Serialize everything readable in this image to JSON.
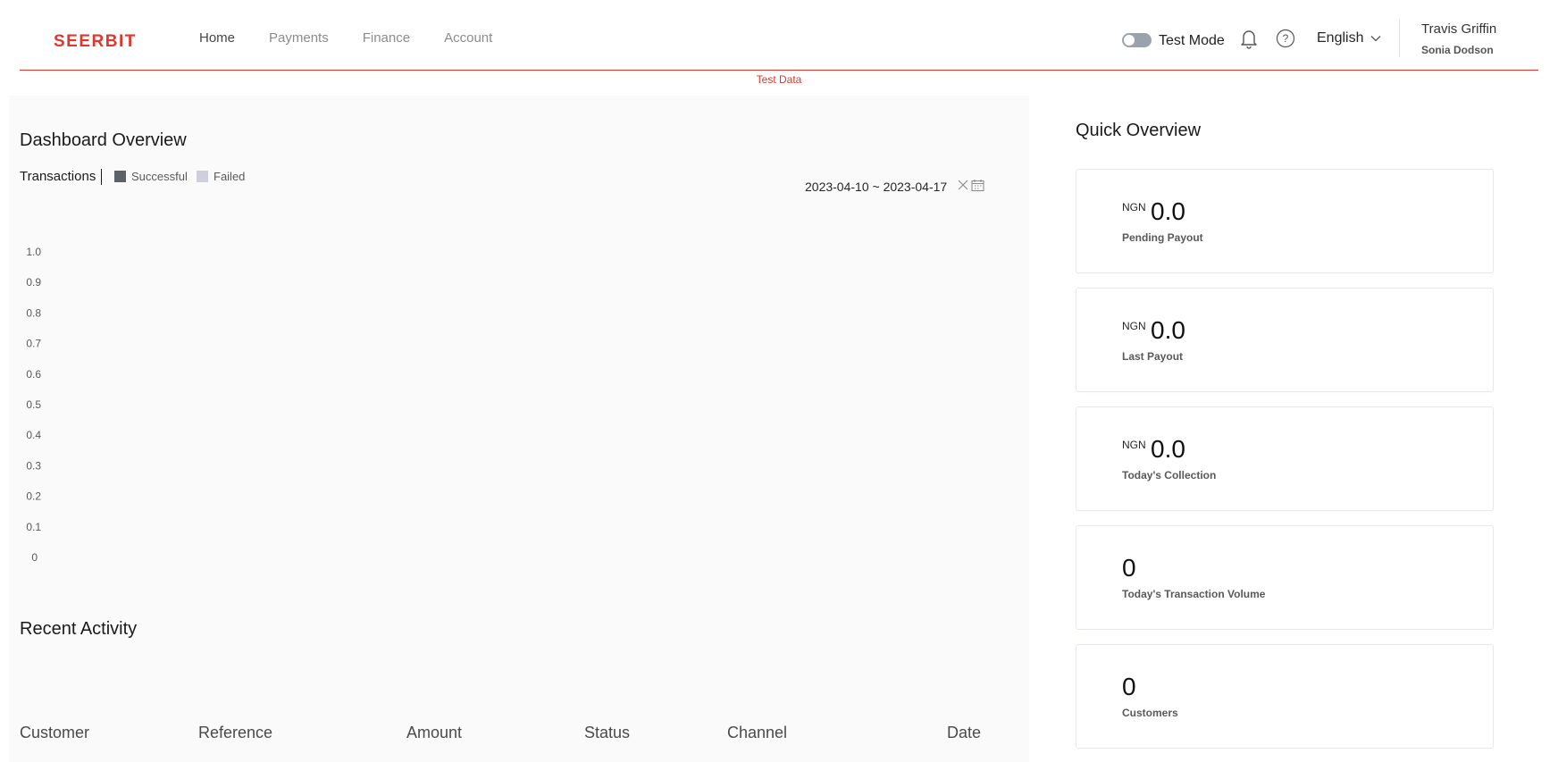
{
  "brand": {
    "name": "SEERBIT",
    "color": "#e0362c"
  },
  "nav": {
    "items": [
      "Home",
      "Payments",
      "Finance",
      "Account"
    ],
    "active": "Home"
  },
  "header": {
    "test_mode_label": "Test Mode",
    "test_mode_on": false,
    "language": "English",
    "user_name": "Travis Griffin",
    "user_business": "Sonia Dodson",
    "test_data_banner": "Test Data"
  },
  "dashboard": {
    "title": "Dashboard Overview",
    "transactions_label": "Transactions",
    "legend": [
      {
        "label": "Successful",
        "color": "#5d6268"
      },
      {
        "label": "Failed",
        "color": "#cfcfdc"
      }
    ],
    "date_range": "2023-04-10 ~ 2023-04-17"
  },
  "chart_data": {
    "type": "bar",
    "categories": [],
    "series": [
      {
        "name": "Successful",
        "values": []
      },
      {
        "name": "Failed",
        "values": []
      }
    ],
    "ylim": [
      0,
      1.0
    ],
    "yticks": [
      "1.0",
      "0.9",
      "0.8",
      "0.7",
      "0.6",
      "0.5",
      "0.4",
      "0.3",
      "0.2",
      "0.1",
      "0"
    ],
    "grid": false,
    "legend_position": "top-left"
  },
  "recent": {
    "title": "Recent Activity",
    "columns": [
      "Customer",
      "Reference",
      "Amount",
      "Status",
      "Channel",
      "Date"
    ]
  },
  "quick_overview": {
    "title": "Quick Overview",
    "cards": [
      {
        "currency": "NGN",
        "value": "0.0",
        "label": "Pending Payout"
      },
      {
        "currency": "NGN",
        "value": "0.0",
        "label": "Last Payout"
      },
      {
        "currency": "NGN",
        "value": "0.0",
        "label": "Today's Collection"
      },
      {
        "currency": "",
        "value": "0",
        "label": "Today's Transaction Volume"
      },
      {
        "currency": "",
        "value": "0",
        "label": "Customers"
      }
    ]
  }
}
